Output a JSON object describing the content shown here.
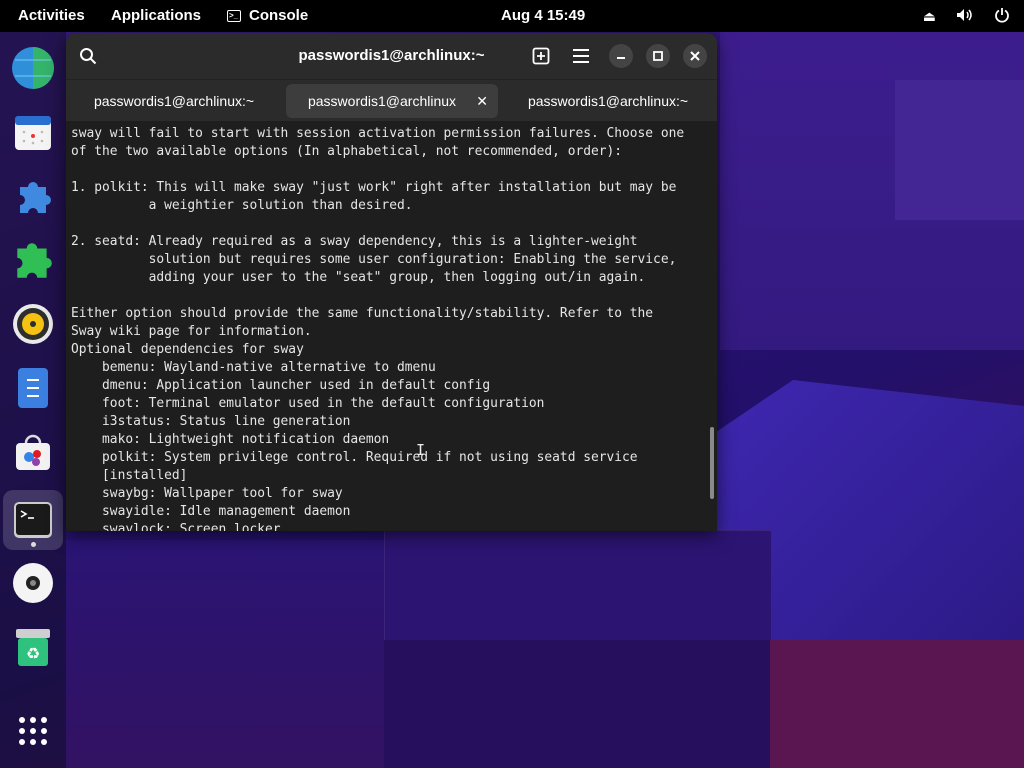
{
  "topbar": {
    "activities": "Activities",
    "applications": "Applications",
    "console": "Console",
    "clock": "Aug 4  15:49"
  },
  "dock": {
    "items": [
      "web-browser",
      "calendar",
      "extensions",
      "extension-manager",
      "rhythmbox",
      "text-editor",
      "software-store",
      "console",
      "disks",
      "trash",
      "show-apps"
    ]
  },
  "window": {
    "title": "passwordis1@archlinux:~",
    "tabs": [
      {
        "label": "passwordis1@archlinux:~",
        "active": false
      },
      {
        "label": "passwordis1@archlinux",
        "active": true
      },
      {
        "label": "passwordis1@archlinux:~",
        "active": false
      }
    ],
    "terminal_lines": [
      "sway will fail to start with session activation permission failures. Choose one",
      "of the two available options (In alphabetical, not recommended, order):",
      "",
      "1. polkit: This will make sway \"just work\" right after installation but may be",
      "          a weightier solution than desired.",
      "",
      "2. seatd: Already required as a sway dependency, this is a lighter-weight",
      "          solution but requires some user configuration: Enabling the service,",
      "          adding your user to the \"seat\" group, then logging out/in again.",
      "",
      "Either option should provide the same functionality/stability. Refer to the",
      "Sway wiki page for information.",
      "Optional dependencies for sway",
      "    bemenu: Wayland-native alternative to dmenu",
      "    dmenu: Application launcher used in default config",
      "    foot: Terminal emulator used in the default configuration",
      "    i3status: Status line generation",
      "    mako: Lightweight notification daemon",
      "    polkit: System privilege control. Required if not using seatd service",
      "    [installed]",
      "    swaybg: Wallpaper tool for sway",
      "    swayidle: Idle management daemon",
      "    swaylock: Screen locker"
    ]
  },
  "icons": {
    "search": "⌕",
    "new_tab": "⊞",
    "menu": "☰",
    "minimize": "–",
    "maximize": "□",
    "close": "✕",
    "tab_close": "✕",
    "eject": "⏏",
    "volume": "🔈",
    "power": "⏻"
  }
}
